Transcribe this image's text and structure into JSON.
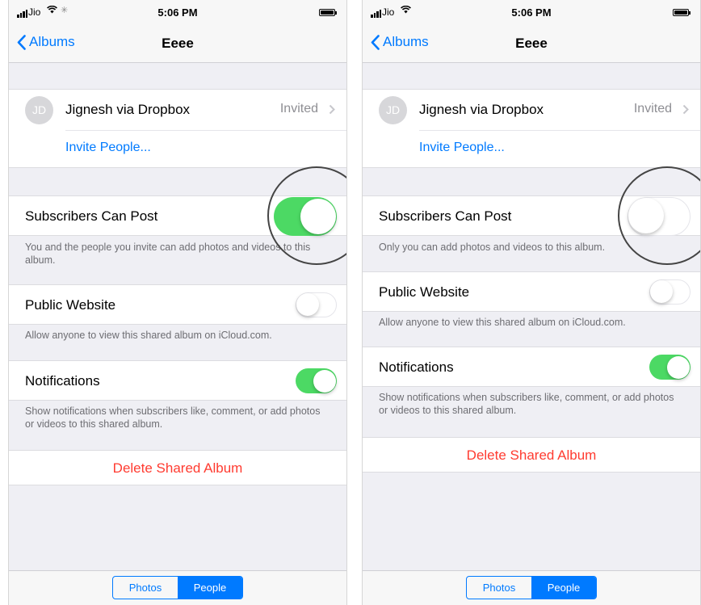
{
  "status_bar": {
    "carrier": "Jio",
    "time": "5:06 PM"
  },
  "nav": {
    "back_label": "Albums",
    "title": "Eeee"
  },
  "person": {
    "initials": "JD",
    "name": "Jignesh via Dropbox",
    "status": "Invited"
  },
  "invite_label": "Invite People...",
  "settings": {
    "subscribers_can_post": {
      "label": "Subscribers Can Post"
    },
    "public_website": {
      "label": "Public Website",
      "note": "Allow anyone to view this shared album on iCloud.com."
    },
    "notifications": {
      "label": "Notifications",
      "note": "Show notifications when subscribers like, comment, or add photos or videos to this shared album."
    }
  },
  "delete_label": "Delete Shared Album",
  "segments": {
    "photos": "Photos",
    "people": "People"
  },
  "left": {
    "subscribers_note": "You and the people you invite can add photos and videos to this album.",
    "subscribers_can_post_on": true,
    "public_website_on": false,
    "notifications_on": true
  },
  "right": {
    "subscribers_note": "Only you can add photos and videos to this album.",
    "subscribers_can_post_on": false,
    "public_website_on": false,
    "notifications_on": true
  },
  "colors": {
    "toggle_on": "#4cd964",
    "accent": "#007aff",
    "destructive": "#ff3b30"
  }
}
